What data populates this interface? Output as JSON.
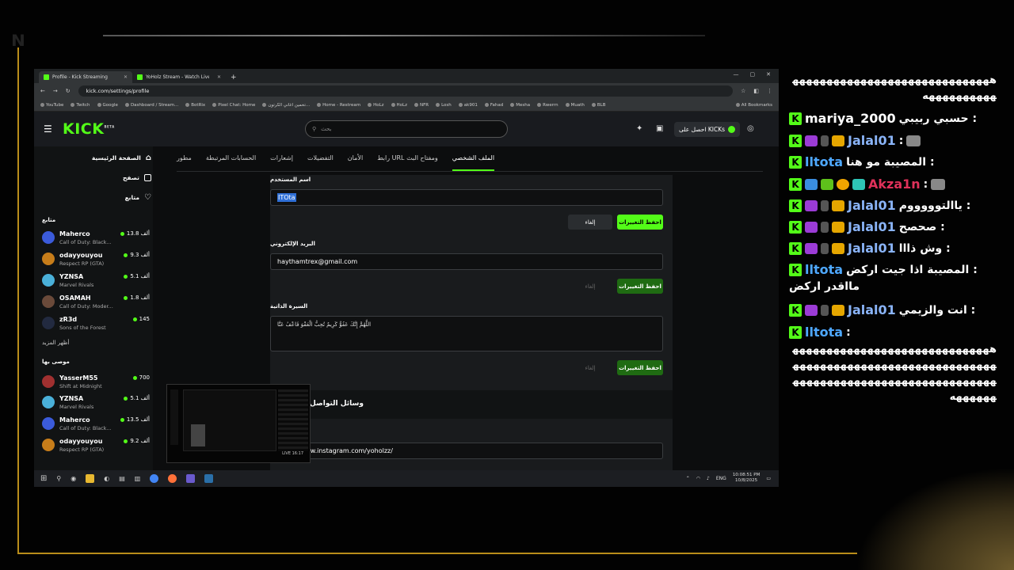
{
  "browser": {
    "tabs": [
      {
        "title": "Profile - Kick Streaming",
        "active": true
      },
      {
        "title": "YoHolz Stream - Watch Live on",
        "active": false
      }
    ],
    "url": "kick.com/settings/profile",
    "bookmarks": [
      "YouTube",
      "Twitch",
      "Google",
      "Dashboard / Stream...",
      "BotRix",
      "Pixel Chat: Home",
      "تخمين اغاني الكرتون...",
      "Home - Restream",
      "HoLz",
      "HoLz",
      "NFR",
      "Losh",
      "ak901",
      "Fahad",
      "Mesha",
      "Rwerrn",
      "Muath",
      "BLB",
      "All Bookmarks"
    ]
  },
  "kick": {
    "logo": "KICK",
    "logo_sup": "BETA",
    "search_placeholder": "بحث",
    "get_kicks": "احصل على KICKs"
  },
  "sidebar": {
    "nav": [
      {
        "label": "الصفحة الرئيسية"
      },
      {
        "label": "تصفح"
      },
      {
        "label": "متابع"
      }
    ],
    "following_title": "متابع",
    "following": [
      {
        "name": "Maherco",
        "game": "Call of Duty: Black...",
        "viewers": "13.8 ألف"
      },
      {
        "name": "odayyouyou",
        "game": "Respect RP (GTA)",
        "viewers": "9.3 ألف"
      },
      {
        "name": "YZNSA",
        "game": "Marvel Rivals",
        "viewers": "5.1 ألف"
      },
      {
        "name": "OSAMAH",
        "game": "Call of Duty: Moder...",
        "viewers": "1.8 ألف"
      },
      {
        "name": "zR3d",
        "game": "Sons of the Forest",
        "viewers": "145"
      }
    ],
    "show_more": "أظهر المزيد",
    "recommended_title": "موصى بها",
    "recommended": [
      {
        "name": "YasserM55",
        "game": "Shift at Midnight",
        "viewers": "700"
      },
      {
        "name": "YZNSA",
        "game": "Marvel Rivals",
        "viewers": "5.1 ألف"
      },
      {
        "name": "Maherco",
        "game": "Call of Duty: Black...",
        "viewers": "13.5 ألف"
      },
      {
        "name": "odayyouyou",
        "game": "Respect RP (GTA)",
        "viewers": "9.2 ألف"
      }
    ]
  },
  "settings": {
    "tabs": [
      "الملف الشخصي",
      "رابط URL ومفتاح البث",
      "الأمان",
      "التفضيلات",
      "إشعارات",
      "الحسابات المرتبطة",
      "مطور"
    ],
    "username_label": "اسم المستخدم",
    "username_value": "ITOta",
    "save": "احفظ التغييرات",
    "cancel": "إلغاء",
    "email_label": "البريد الإلكتروني",
    "email_value": "haythamtrex@gmail.com",
    "bio_label": "السيرة الذاتية",
    "bio_value": "اللَّهُمَّ إِنَّكَ عَفُوٌّ كَرِيمٌ تُحِبُّ الْعَفْوَ فَاعْفُ عَنَّا",
    "social_title": "وسائل التواصل",
    "instagram_value": "https://www.instagram.com/yoholzz/"
  },
  "taskbar": {
    "lang": "ENG",
    "time": "10:08:51 PM",
    "date": "10/8/2025"
  },
  "chat": {
    "line0": "ههههههههههههههههههههههههههههههههههههههههه",
    "line1_user": "mariya_2000",
    "line1_msg": "حسبي ربيبي :",
    "line2_user": "Jalal01",
    "line3_user": "lltota",
    "line3_msg": "المصيبة مو هنا :",
    "line4_user": "Akza1n",
    "line5_user": "Jalal01",
    "line5_msg": "ياالتوووووم :",
    "line6_user": "Jalal01",
    "line6_msg": "صحصح :",
    "line7_user": "Jalal01",
    "line7_msg": "وش ذااا :",
    "line8_user": "lltota",
    "line8_msg": "المصيبة اذا جيت اركض :",
    "line8_msg2": "مااقدر اركض",
    "line9_user": "Jalal01",
    "line9_msg": "انت والزيمي :",
    "line10_user": "lltota",
    "line10_msg": "ههههههههههههههههههههههههههههههههههههههههههههههههههههههههههههههههههههههههههههههههههههههههههههههههه",
    "colon": ":",
    "colors": {
      "mariya": "#ffffff",
      "jalal": "#8ab4f8",
      "lltota": "#4ea8ff",
      "akza": "#e0315a"
    }
  },
  "preview": {
    "live": "LIVE 16:17"
  }
}
